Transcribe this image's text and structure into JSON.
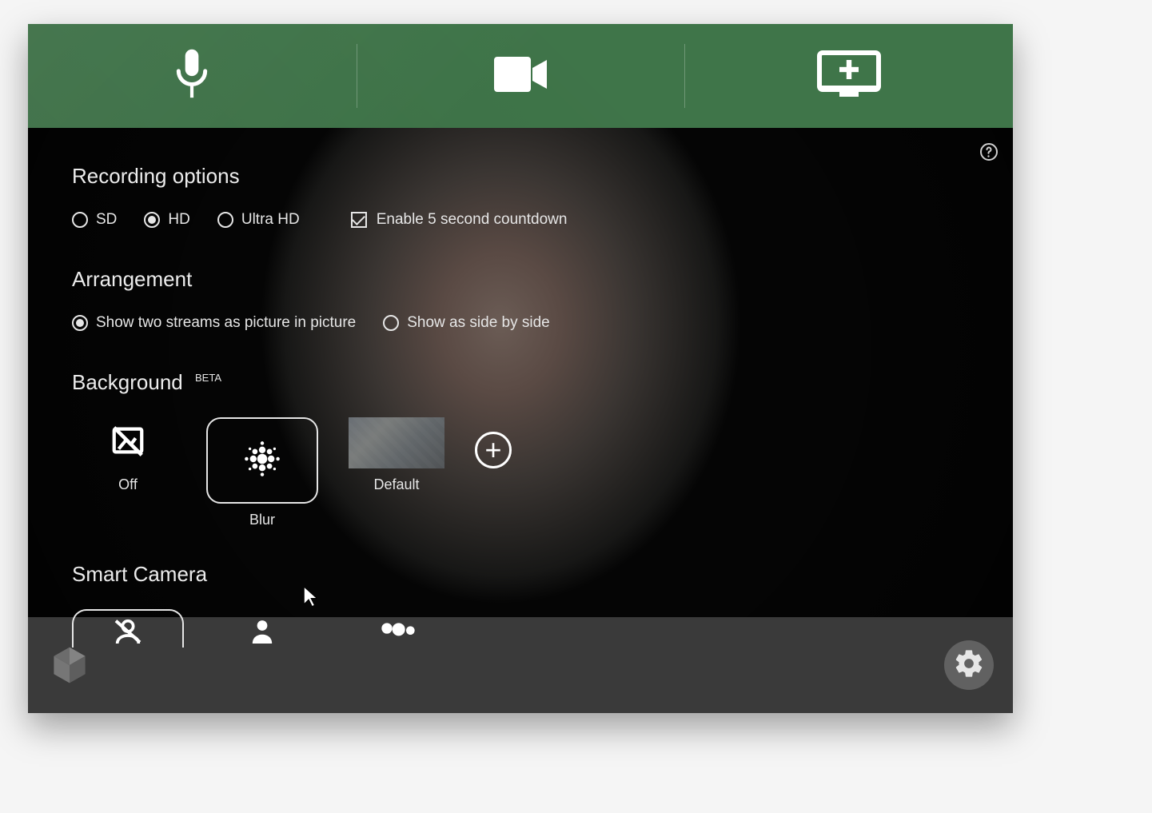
{
  "sections": {
    "recording_title": "Recording options",
    "arrangement_title": "Arrangement",
    "background_title": "Background",
    "background_badge": "BETA",
    "smartcamera_title": "Smart Camera"
  },
  "recording": {
    "quality": [
      {
        "value": "sd",
        "label": "SD",
        "selected": false
      },
      {
        "value": "hd",
        "label": "HD",
        "selected": true
      },
      {
        "value": "uhd",
        "label": "Ultra HD",
        "selected": false
      }
    ],
    "countdown": {
      "label": "Enable 5 second countdown",
      "checked": true
    }
  },
  "arrangement": {
    "options": [
      {
        "value": "pip",
        "label": "Show two streams as picture in picture",
        "selected": true
      },
      {
        "value": "side",
        "label": "Show as side by side",
        "selected": false
      }
    ]
  },
  "background": {
    "options": [
      {
        "value": "off",
        "label": "Off",
        "selected": false
      },
      {
        "value": "blur",
        "label": "Blur",
        "selected": true
      },
      {
        "value": "default",
        "label": "Default",
        "selected": false
      }
    ]
  },
  "colors": {
    "topbar": "#3f7549",
    "footer": "#3a3a3a"
  }
}
